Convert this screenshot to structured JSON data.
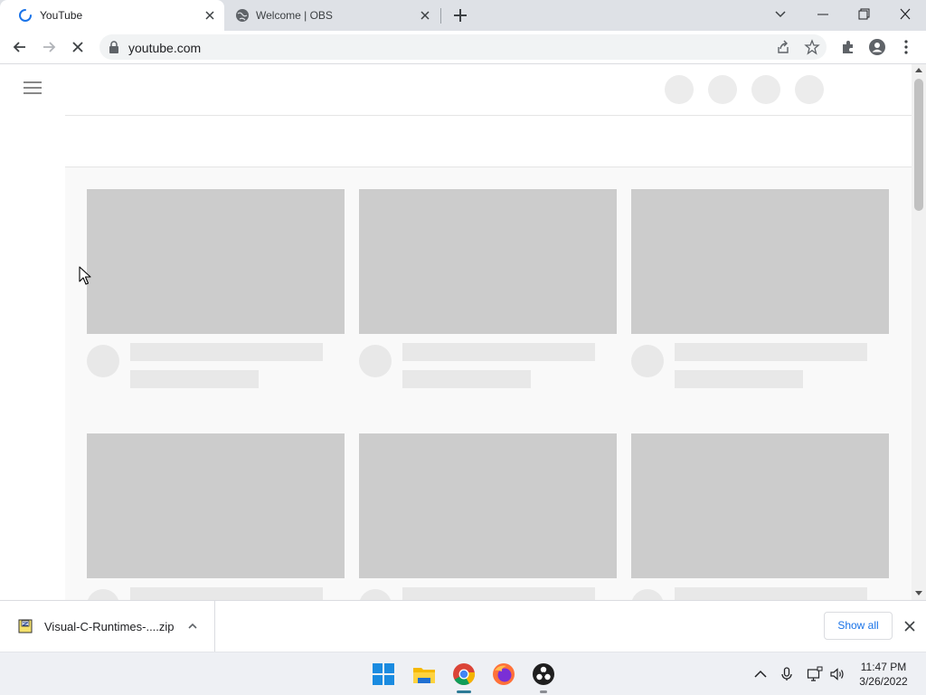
{
  "browser": {
    "tabs": [
      {
        "title": "YouTube",
        "active": true,
        "loading": true
      },
      {
        "title": "Welcome | OBS",
        "active": false
      }
    ],
    "address": "youtube.com"
  },
  "page": {
    "state": "loading-skeleton",
    "header_placeholder_count": 4,
    "grid_columns": 3,
    "grid_rows_visible": 2
  },
  "downloads": {
    "file_name": "Visual-C-Runtimes-....zip",
    "show_all_label": "Show all"
  },
  "taskbar": {
    "apps": [
      "windows-start-icon",
      "file-explorer-icon",
      "chrome-icon",
      "firefox-icon",
      "obs-icon"
    ],
    "time": "11:47 PM",
    "date": "3/26/2022"
  },
  "colors": {
    "tabstrip": "#dee1e6",
    "skeleton": "#cccccc",
    "skeleton_light": "#e8e8e8",
    "link_blue": "#1a73e8"
  }
}
